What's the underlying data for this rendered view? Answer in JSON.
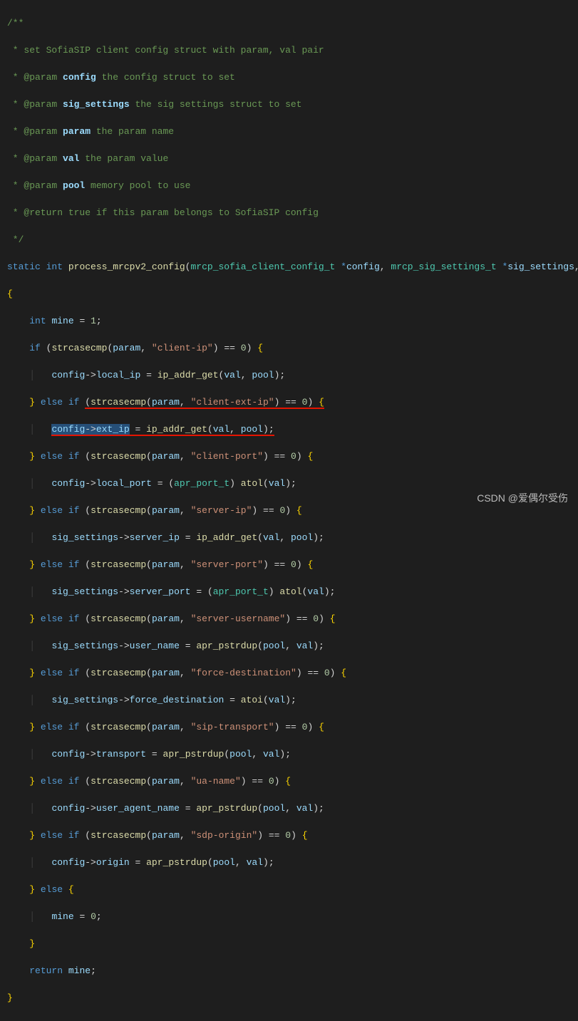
{
  "doc": {
    "block_open": "/**",
    "l1": " * set SofiaSIP client config struct with param, val pair",
    "p1_tag": " * @param ",
    "p1_name": "config",
    "p1_desc": " the config struct to set",
    "p2_tag": " * @param ",
    "p2_name": "sig_settings",
    "p2_desc": " the sig settings struct to set",
    "p3_tag": " * @param ",
    "p3_name": "param",
    "p3_desc": " the param name",
    "p4_tag": " * @param ",
    "p4_name": "val",
    "p4_desc": " the param value",
    "p5_tag": " * @param ",
    "p5_name": "pool",
    "p5_desc": " memory pool to use",
    "ret_tag": " * @return ",
    "ret_desc": "true if this param belongs to SofiaSIP config",
    "block_close": " */"
  },
  "sig": {
    "static": "static",
    "int": "int",
    "fn": "process_mrcpv2_config",
    "t1": "mrcp_sofia_client_config_t",
    "a1": "config",
    "t2": "mrcp_sig_settings_t",
    "a2": "sig_settings"
  },
  "body": {
    "int_kw": "int",
    "mine": "mine",
    "one": "1",
    "zero": "0",
    "if_kw": "if",
    "else_kw": "else",
    "return_kw": "return",
    "strcasecmp": "strcasecmp",
    "param": "param",
    "val": "val",
    "pool": "pool",
    "atol": "atol",
    "atoi": "atoi",
    "ip_addr_get": "ip_addr_get",
    "apr_pstrdup": "apr_pstrdup",
    "apr_port_t": "apr_port_t",
    "config": "config",
    "sig_settings": "sig_settings",
    "s_client_ip": "\"client-ip\"",
    "s_client_ext_ip": "\"client-ext-ip\"",
    "s_client_port": "\"client-port\"",
    "s_server_ip": "\"server-ip\"",
    "s_server_port": "\"server-port\"",
    "s_server_username": "\"server-username\"",
    "s_force_destination": "\"force-destination\"",
    "s_sip_transport": "\"sip-transport\"",
    "s_ua_name": "\"ua-name\"",
    "s_sdp_origin": "\"sdp-origin\"",
    "local_ip": "local_ip",
    "ext_ip": "ext_ip",
    "local_port": "local_port",
    "server_ip": "server_ip",
    "server_port": "server_port",
    "user_name": "user_name",
    "force_destination": "force_destination",
    "transport": "transport",
    "user_agent_name": "user_agent_name",
    "origin": "origin"
  },
  "watermark": "CSDN @爱偶尔受伤"
}
